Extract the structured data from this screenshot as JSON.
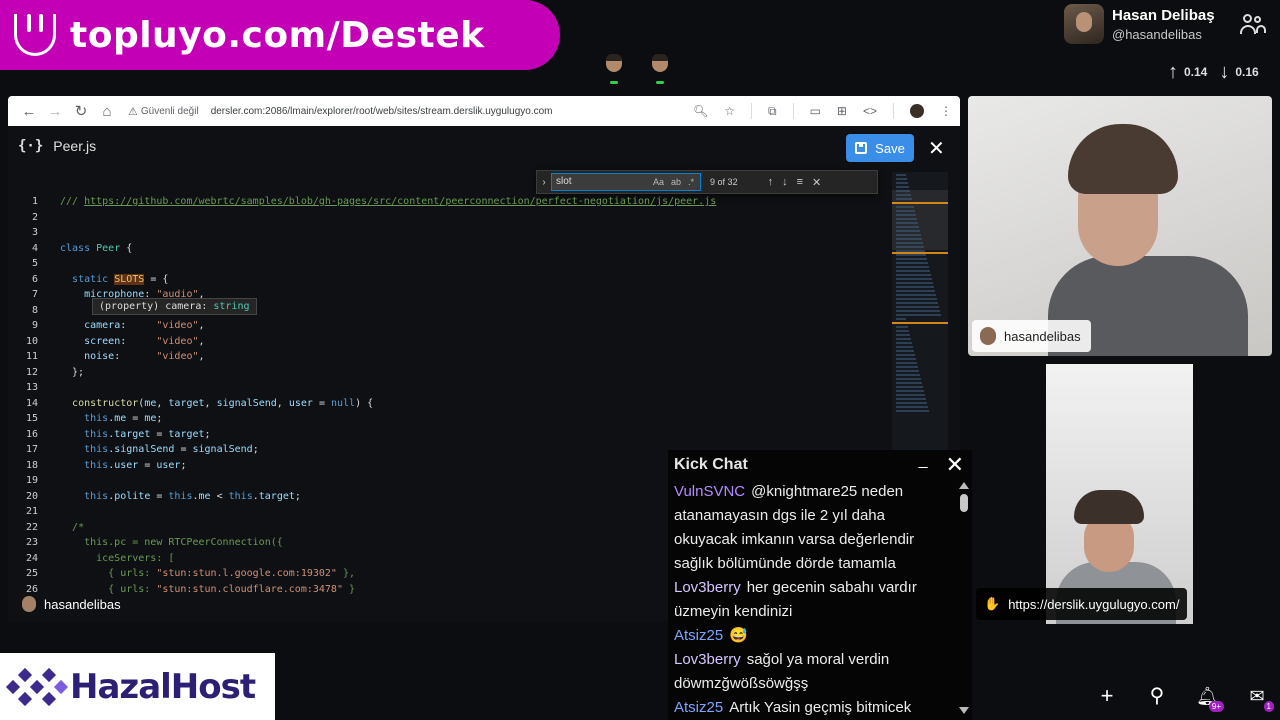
{
  "banner": {
    "text": "topluyo.com/Destek"
  },
  "profile": {
    "name": "Hasan Delibaş",
    "handle": "@hasandelibas"
  },
  "stats": {
    "up": "0.14",
    "down": "0.16"
  },
  "browser": {
    "secure_label": "Güvenli değil",
    "url": "dersler.com:2086/lmain/explorer/root/web/sites/stream.derslik.uygulugyo.com"
  },
  "editor": {
    "file_name": "Peer.js",
    "save_label": "Save",
    "find": {
      "query": "slot",
      "count": "9 of 32",
      "opt_case": "Aa",
      "opt_word": "ab",
      "opt_regex": ".*"
    },
    "tooltip": {
      "prefix": "(property) camera: ",
      "type": "string"
    },
    "streamer": "hasandelibas",
    "lines": [
      {
        "n": "1",
        "html": "<span class='cmt'>/// </span><span class='link'>https://github.com/webrtc/samples/blob/gh-pages/src/content/peerconnection/perfect-negotiation/js/peer.js</span>"
      },
      {
        "n": "2",
        "html": ""
      },
      {
        "n": "3",
        "html": ""
      },
      {
        "n": "4",
        "html": "<span class='kw'>class</span> <span class='cls'>Peer</span> {"
      },
      {
        "n": "5",
        "html": ""
      },
      {
        "n": "6",
        "html": "  <span class='kw'>static</span> <span class='hl'>SLOTS</span> = {"
      },
      {
        "n": "7",
        "html": "    <span class='var'>microphone</span>: <span class='str'>\"audio\"</span>,"
      },
      {
        "n": "8",
        "html": ""
      },
      {
        "n": "9",
        "html": "    <span class='var'>camera</span>:     <span class='str'>\"video\"</span>,"
      },
      {
        "n": "10",
        "html": "    <span class='var'>screen</span>:     <span class='str'>\"video\"</span>,"
      },
      {
        "n": "11",
        "html": "    <span class='var'>noise</span>:      <span class='str'>\"video\"</span>,"
      },
      {
        "n": "12",
        "html": "  };"
      },
      {
        "n": "13",
        "html": ""
      },
      {
        "n": "14",
        "html": "  <span class='fn'>constructor</span>(<span class='var'>me</span>, <span class='var'>target</span>, <span class='var'>signalSend</span>, <span class='var'>user</span> = <span class='kw'>null</span>) {"
      },
      {
        "n": "15",
        "html": "    <span class='kw'>this</span>.<span class='var'>me</span> = <span class='var'>me</span>;"
      },
      {
        "n": "16",
        "html": "    <span class='kw'>this</span>.<span class='var'>target</span> = <span class='var'>target</span>;"
      },
      {
        "n": "17",
        "html": "    <span class='kw'>this</span>.<span class='var'>signalSend</span> = <span class='var'>signalSend</span>;"
      },
      {
        "n": "18",
        "html": "    <span class='kw'>this</span>.<span class='var'>user</span> = <span class='var'>user</span>;"
      },
      {
        "n": "19",
        "html": ""
      },
      {
        "n": "20",
        "html": "    <span class='kw'>this</span>.<span class='var'>polite</span> = <span class='kw'>this</span>.<span class='var'>me</span> &lt; <span class='kw'>this</span>.<span class='var'>target</span>;"
      },
      {
        "n": "21",
        "html": ""
      },
      {
        "n": "22",
        "html": "  <span class='cmt'>/*</span>"
      },
      {
        "n": "23",
        "html": "<span class='cmt'>    this.pc = new RTCPeerConnection({</span>"
      },
      {
        "n": "24",
        "html": "<span class='cmt'>      iceServers: [</span>"
      },
      {
        "n": "25",
        "html": "<span class='cmt'>        { urls: </span><span class='str'>\"stun:stun.l.google.com:19302\"</span><span class='cmt'> },</span>"
      },
      {
        "n": "26",
        "html": "<span class='cmt'>        { urls: </span><span class='str'>\"stun:stun.cloudflare.com:3478\"</span><span class='cmt'> }</span>"
      }
    ]
  },
  "cams": {
    "cam1_label": "hasandelibas",
    "cam2_url": "https://derslik.uygulugyo.com/"
  },
  "chat": {
    "title": "Kick Chat",
    "messages": [
      {
        "user": "VulnSVNC",
        "color": "#b48cff",
        "text": "@knightmare25 neden atanamayasın dgs ile 2 yıl daha okuyacak imkanın varsa değerlendir sağlık bölümünde dörde tamamla"
      },
      {
        "user": "Lov3berry",
        "color": "#d6c6ff",
        "text": "her gecenin sabahı vardır üzmeyin kendinizi"
      },
      {
        "user": "Atsiz25",
        "color": "#7ea4ff",
        "text": "😅"
      },
      {
        "user": "Lov3berry",
        "color": "#d6c6ff",
        "text": "sağol ya moral verdin döwmzğwößsöwğşş"
      },
      {
        "user": "Atsiz25",
        "color": "#7ea4ff",
        "text": "Artık Yasin geçmiş bitmicek"
      }
    ]
  },
  "logo": {
    "text": "HazalHost"
  },
  "notifications": {
    "bell_badge": "9+",
    "mail_badge": "1"
  }
}
